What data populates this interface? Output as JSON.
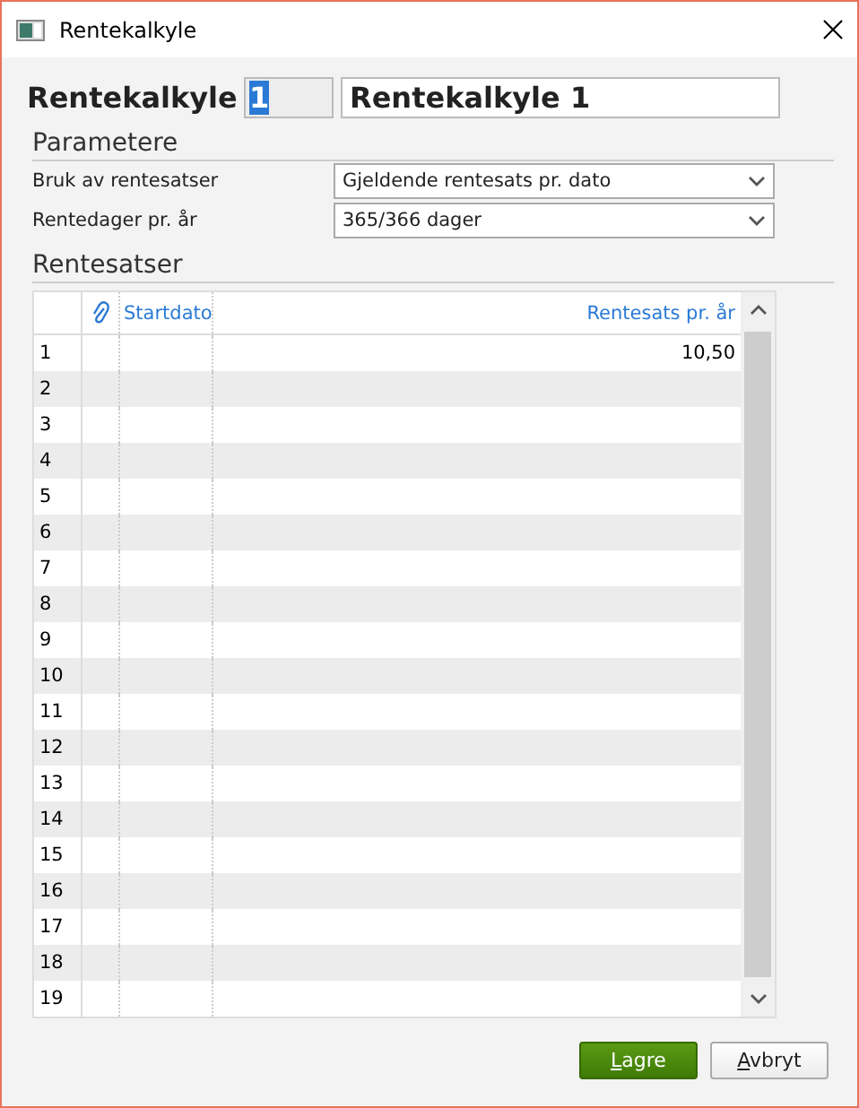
{
  "window": {
    "title": "Rentekalkyle"
  },
  "header": {
    "label": "Rentekalkyle",
    "number": {
      "value": "1",
      "selected": true
    },
    "name": {
      "value": "Rentekalkyle 1"
    }
  },
  "parameters": {
    "heading": "Parametere",
    "fields": [
      {
        "label": "Bruk av rentesatser",
        "value": "Gjeldende rentesats pr. dato"
      },
      {
        "label": "Rentedager pr. år",
        "value": "365/366 dager"
      }
    ]
  },
  "rates": {
    "heading": "Rentesatser",
    "columns": [
      "Startdato",
      "Rentesats pr. år"
    ],
    "rows": [
      {
        "row": "1",
        "rate": "10,50"
      },
      {
        "row": "2"
      },
      {
        "row": "3"
      },
      {
        "row": "4"
      },
      {
        "row": "5"
      },
      {
        "row": "6"
      },
      {
        "row": "7"
      },
      {
        "row": "8"
      },
      {
        "row": "9"
      },
      {
        "row": "10"
      },
      {
        "row": "11"
      },
      {
        "row": "12"
      },
      {
        "row": "13"
      },
      {
        "row": "14"
      },
      {
        "row": "15"
      },
      {
        "row": "16"
      },
      {
        "row": "17"
      },
      {
        "row": "18"
      },
      {
        "row": "19"
      }
    ]
  },
  "buttons": [
    {
      "label": "Lagre",
      "kind": "primary"
    },
    {
      "label": "Avbryt",
      "kind": "secondary"
    }
  ]
}
